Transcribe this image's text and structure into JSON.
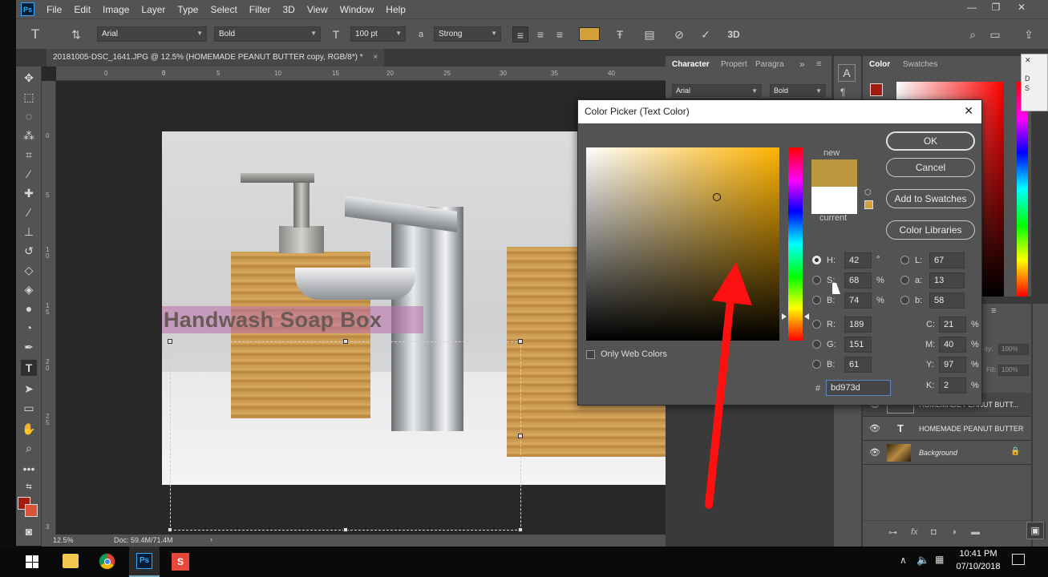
{
  "app": {
    "logo_text": "Ps",
    "menu": [
      "File",
      "Edit",
      "Image",
      "Layer",
      "Type",
      "Select",
      "Filter",
      "3D",
      "View",
      "Window",
      "Help"
    ]
  },
  "options_bar": {
    "font_family": "Arial",
    "font_style": "Bold",
    "font_size": "100 pt",
    "aa_label": "a",
    "antialias": "Strong",
    "text_color_hex": "#d4a03a"
  },
  "document": {
    "tab_title": "20181005-DSC_1641.JPG @ 12.5% (HOMEMADE PEANUT BUTTER copy, RGB/8*) *",
    "close_glyph": "×",
    "zoom": "12.5%",
    "doc_size": "Doc: 59.4M/71.4M",
    "status_arrow": "›",
    "canvas_text": "Handwash Soap Box",
    "ruler_top": [
      "0",
      "5",
      "0",
      "5",
      "10",
      "15",
      "20",
      "25",
      "30",
      "35",
      "40"
    ],
    "ruler_left": [
      "0",
      "5",
      "1",
      "0",
      "1",
      "5",
      "2",
      "0",
      "2",
      "5",
      "3"
    ]
  },
  "character_panel": {
    "tabs": [
      "Character",
      "Propert",
      "Paragra"
    ],
    "more": "»",
    "font_family": "Arial",
    "font_style": "Bold"
  },
  "color_panel": {
    "tabs": [
      "Color",
      "Swatches"
    ],
    "fg_hex": "#a31c12"
  },
  "popup_labels": [
    "D",
    "S"
  ],
  "color_picker": {
    "title": "Color Picker (Text Color)",
    "close": "✕",
    "new_label": "new",
    "current_label": "current",
    "new_hex": "#bd973d",
    "current_hex": "#ffffff",
    "buttons": {
      "ok": "OK",
      "cancel": "Cancel",
      "add_swatches": "Add to Swatches",
      "color_libraries": "Color Libraries"
    },
    "only_web_colors": "Only Web Colors",
    "hsb": [
      {
        "label": "H:",
        "value": "42",
        "unit": "°"
      },
      {
        "label": "S:",
        "value": "68",
        "unit": "%"
      },
      {
        "label": "B:",
        "value": "74",
        "unit": "%"
      }
    ],
    "rgb": [
      {
        "label": "R:",
        "value": "189"
      },
      {
        "label": "G:",
        "value": "151"
      },
      {
        "label": "B:",
        "value": "61"
      }
    ],
    "lab": [
      {
        "label": "L:",
        "value": "67"
      },
      {
        "label": "a:",
        "value": "13"
      },
      {
        "label": "b:",
        "value": "58"
      }
    ],
    "cmyk": [
      {
        "label": "C:",
        "value": "21",
        "unit": "%"
      },
      {
        "label": "M:",
        "value": "40",
        "unit": "%"
      },
      {
        "label": "Y:",
        "value": "97",
        "unit": "%"
      },
      {
        "label": "K:",
        "value": "2",
        "unit": "%"
      }
    ],
    "hash": "#",
    "hex": "bd973d"
  },
  "layers_panel": {
    "opacity_label": "ity:",
    "opacity_value": "100%",
    "fill_label": "Fill:",
    "fill_value": "100%",
    "layers": [
      {
        "name": "HOMEMADE PEANUT BUTT...",
        "kind": "text"
      },
      {
        "name": "HOMEMADE PEANUT BUTTER",
        "kind": "text"
      },
      {
        "name": "Background",
        "kind": "image",
        "locked": true
      }
    ]
  },
  "taskbar": {
    "time": "10:41 PM",
    "date": "07/10/2018"
  }
}
